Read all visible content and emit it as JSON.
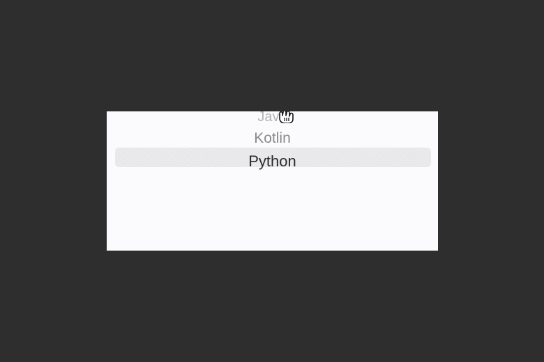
{
  "picker": {
    "items": [
      {
        "label": "Java"
      },
      {
        "label": "Kotlin"
      },
      {
        "label": "Python"
      }
    ],
    "selected": "Python"
  },
  "cursor": {
    "icon": "hand-pointer-icon"
  },
  "colors": {
    "backdrop": "#2e2e2e",
    "card": "#fbfbfe",
    "selected_text": "#2b2b2b",
    "faded_text": "#8a8a8a"
  }
}
